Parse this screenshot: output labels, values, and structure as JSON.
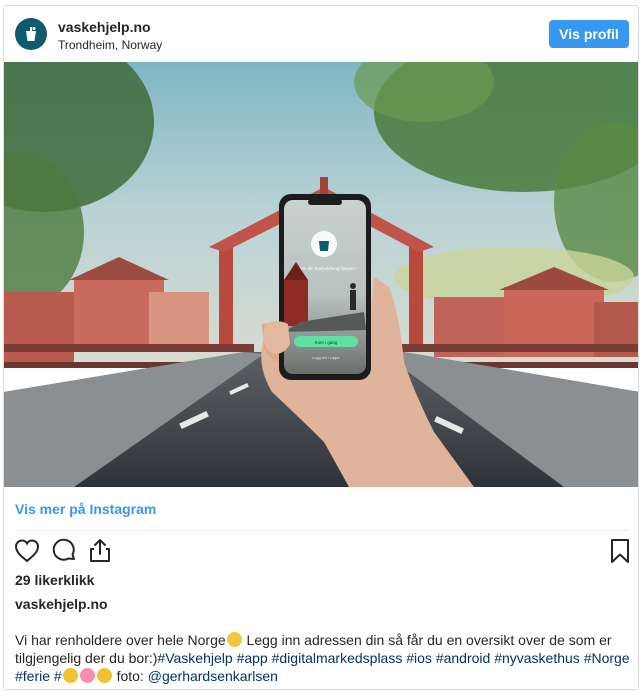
{
  "header": {
    "username": "vaskehjelp.no",
    "location": "Trondheim, Norway",
    "profile_button": "Vis profil",
    "avatar_icon": "bucket-icon"
  },
  "photo": {
    "phone_screen": {
      "tagline": "Finner din husholdning hjelper?",
      "start_button": "Kom i gang",
      "login_link": "Logg inn / Lagre"
    }
  },
  "more_link": "Vis mer på Instagram",
  "actions": {
    "like_icon": "heart-icon",
    "comment_icon": "comment-icon",
    "share_icon": "share-icon",
    "save_icon": "bookmark-icon"
  },
  "likes": "29 likerklikk",
  "owner": "vaskehjelp.no",
  "caption": {
    "line1_a": "Vi har renholdere over hele Norge",
    "line1_b": " Legg inn adressen din så får du en oversikt over de som er",
    "line2_a": "tilgjengelig der du bor:)",
    "hashtags": [
      "#Vaskehjelp",
      "#app",
      "#digitalmarkedsplass",
      "#ios",
      "#android",
      "#nyvaskethus",
      "#Norge",
      "#ferie",
      "#"
    ],
    "credit": " foto: ",
    "mention": "@gerhardsenkarlsen"
  },
  "colors": {
    "accent": "#3897f0",
    "avatar": "#0f5b6e",
    "hashtag": "#003569",
    "app_green": "#5fe0a0"
  }
}
